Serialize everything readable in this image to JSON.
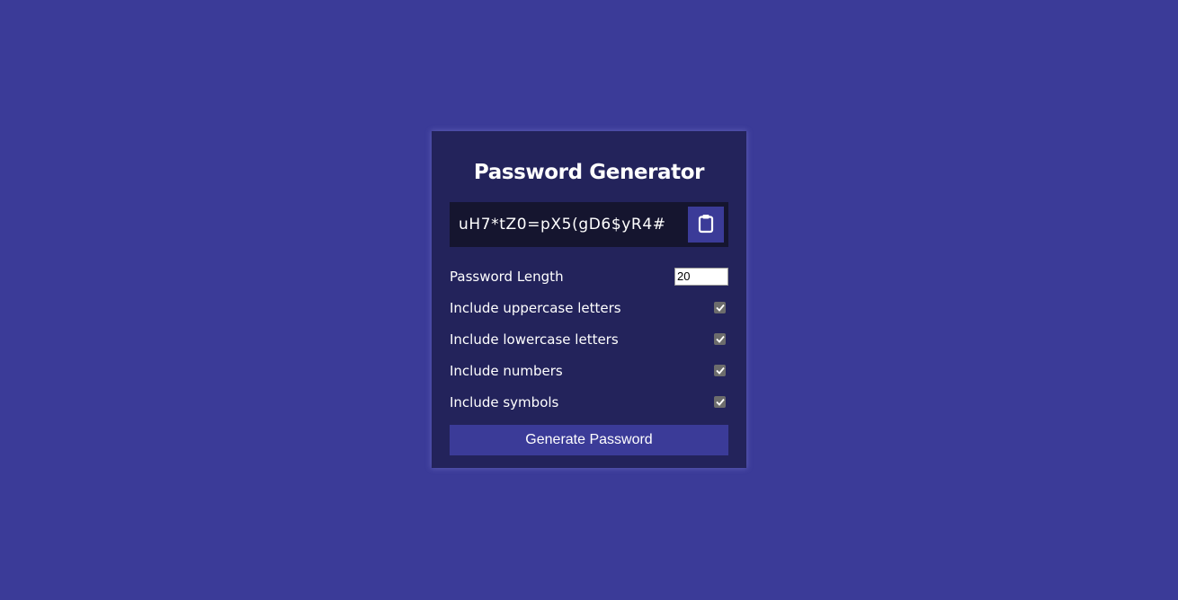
{
  "app": {
    "title": "Password Generator"
  },
  "result": {
    "password": "uH7*tZ0=pX5(gD6$yR4#",
    "clipboard_icon": "clipboard-icon"
  },
  "settings": {
    "length_label": "Password Length",
    "length_value": "20",
    "options": [
      {
        "label": "Include uppercase letters",
        "checked": true
      },
      {
        "label": "Include lowercase letters",
        "checked": true
      },
      {
        "label": "Include numbers",
        "checked": true
      },
      {
        "label": "Include symbols",
        "checked": true
      }
    ]
  },
  "generate_button": {
    "label": "Generate Password"
  },
  "colors": {
    "background": "#3b3b98",
    "card": "#23235b",
    "result_box": "#15152f",
    "button": "#3b3b98",
    "text": "#ffffff"
  }
}
